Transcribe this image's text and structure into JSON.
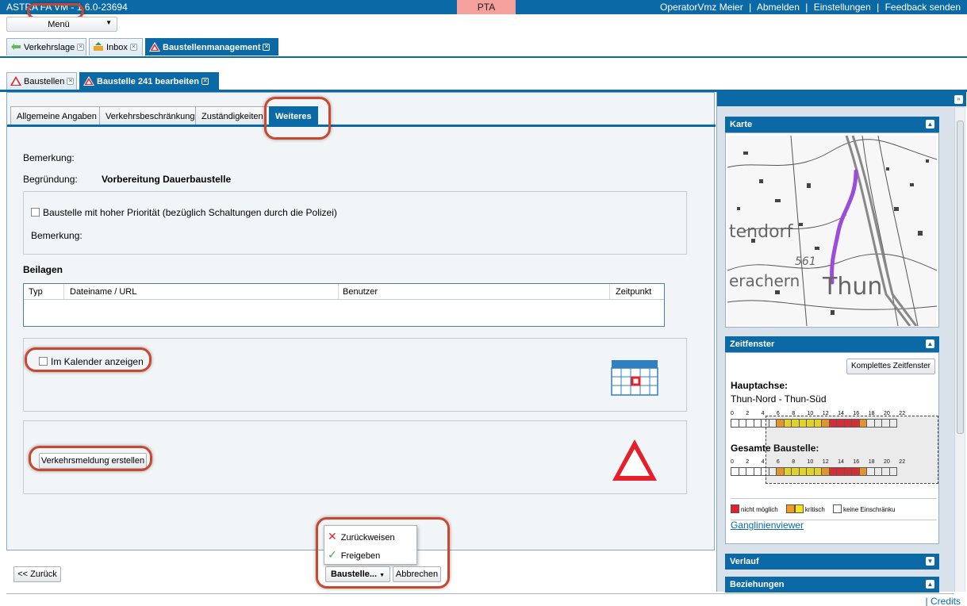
{
  "topbar": {
    "app_title": "ASTRA FA VM - 1.6.0-23694",
    "environment": "PTA",
    "user": "OperatorVmz Meier",
    "logout": "Abmelden",
    "settings": "Einstellungen",
    "feedback": "Feedback senden",
    "sep": "|"
  },
  "menu": {
    "label": "Menü"
  },
  "main_tabs": [
    {
      "label": "Verkehrslage"
    },
    {
      "label": "Inbox"
    },
    {
      "label": "Baustellenmanagement"
    }
  ],
  "sub_tabs": [
    {
      "label": "Baustellen"
    },
    {
      "label": "Baustelle 241 bearbeiten"
    }
  ],
  "inner_tabs": [
    {
      "label": "Allgemeine Angaben"
    },
    {
      "label": "Verkehrsbeschränkung"
    },
    {
      "label": "Zuständigkeiten"
    },
    {
      "label": "Weiteres"
    }
  ],
  "form": {
    "bemerkung_label": "Bemerkung:",
    "begruendung_label": "Begründung:",
    "begruendung_value": "Vorbereitung Dauerbaustelle",
    "priority_checkbox": "Baustelle mit hoher Priorität (bezüglich Schaltungen durch die Polizei)",
    "bemerkung2_label": "Bemerkung:",
    "beilagen_title": "Beilagen",
    "table_headers": [
      "Typ",
      "Dateiname / URL",
      "Benutzer",
      "Zeitpunkt"
    ],
    "calendar_checkbox": "Im Kalender anzeigen",
    "traffic_button": "Verkehrsmeldung erstellen"
  },
  "actions": {
    "back": "<< Zurück",
    "baustelle_menu": "Baustelle...",
    "cancel": "Abbrechen",
    "menu_items": [
      "Zurückweisen",
      "Freigeben"
    ]
  },
  "sidebar": {
    "karte_title": "Karte",
    "map_labels": [
      "tendorf",
      "561",
      "erachern",
      "Thun"
    ],
    "zeitfenster_title": "Zeitfenster",
    "komplett_button": "Komplettes Zeitfenster",
    "hauptachse_label": "Hauptachse:",
    "hauptachse_value": "Thun-Nord - Thun-Süd",
    "gesamte_label": "Gesamte Baustelle:",
    "hours": [
      "0",
      "2",
      "4",
      "6",
      "8",
      "10",
      "12",
      "14",
      "16",
      "18",
      "20",
      "22"
    ],
    "slots_hauptachse": [
      "w",
      "w",
      "w",
      "w",
      "w",
      "w",
      "o",
      "y",
      "y",
      "y",
      "y",
      "y",
      "o",
      "r",
      "r",
      "r",
      "r",
      "o",
      "w",
      "w",
      "w",
      "w"
    ],
    "slots_gesamt": [
      "w",
      "w",
      "w",
      "w",
      "w",
      "w",
      "o",
      "y",
      "y",
      "y",
      "y",
      "y",
      "o",
      "r",
      "r",
      "r",
      "r",
      "o",
      "w",
      "w",
      "w",
      "w"
    ],
    "legend": [
      "nicht möglich",
      "kritisch",
      "keine Einschränku"
    ],
    "ganglinien_link": "Ganglinienviewer",
    "verlauf_title": "Verlauf",
    "beziehungen_title": "Beziehungen",
    "colors": {
      "red": "#e5202a",
      "orange": "#f39b1f",
      "yellow": "#f5e21c",
      "white": "#ffffff"
    }
  },
  "footer": {
    "credits": "| Credits"
  }
}
